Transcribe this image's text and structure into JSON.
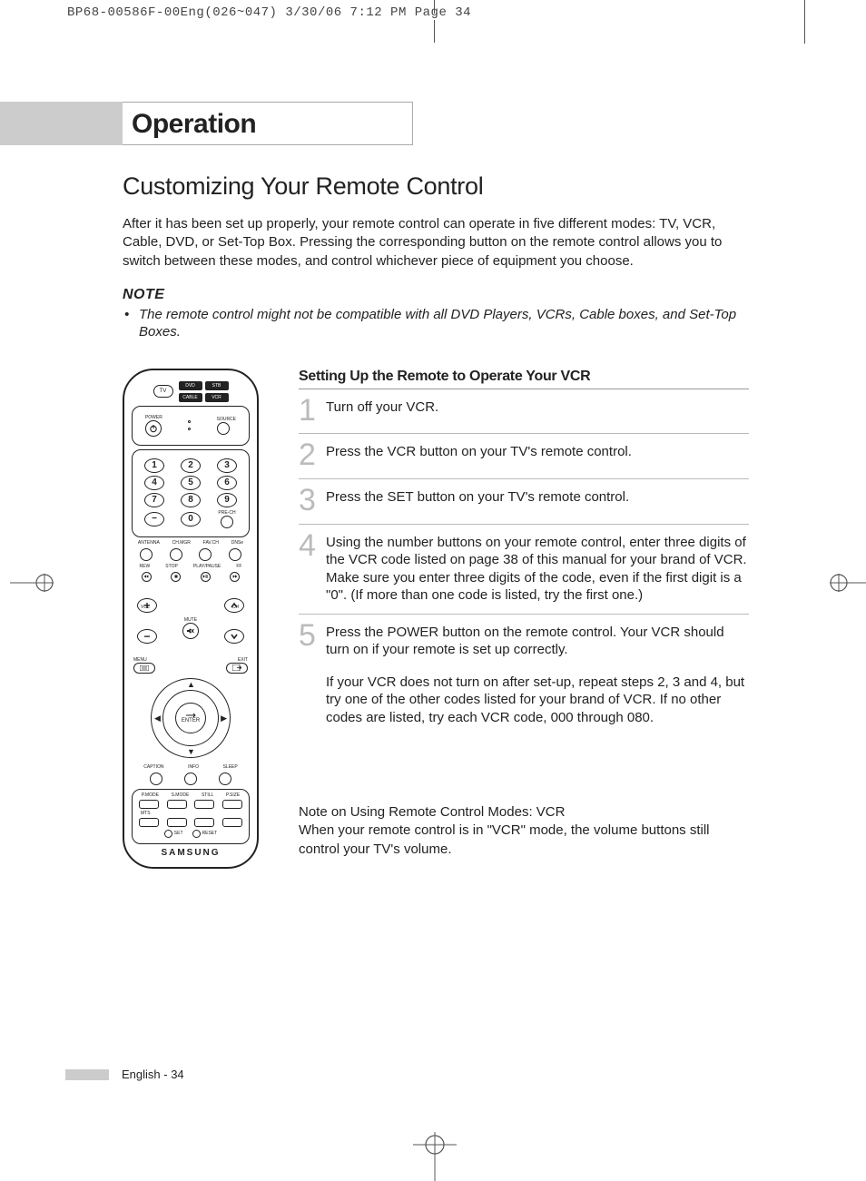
{
  "print_header": "BP68-00586F-00Eng(026~047)  3/30/06  7:12 PM  Page 34",
  "chapter": "Operation",
  "section_title": "Customizing Your Remote Control",
  "intro": "After it has been set up properly, your remote control can operate in five different modes: TV, VCR, Cable, DVD, or Set-Top Box. Pressing the corresponding button on the remote control allows you to switch between these modes, and control whichever piece of equipment you choose.",
  "note_head": "NOTE",
  "note_body": "The remote control might not be compatible with all DVD Players, VCRs, Cable boxes, and Set-Top Boxes.",
  "sub_title": "Setting Up the Remote to Operate Your VCR",
  "steps": [
    {
      "n": "1",
      "text": "Turn off your VCR."
    },
    {
      "n": "2",
      "text": "Press the VCR button on your TV's remote control."
    },
    {
      "n": "3",
      "text": "Press the SET button on your TV's remote control."
    },
    {
      "n": "4",
      "text": "Using the number buttons on your remote control, enter three digits of the VCR code listed on page 38 of this manual for your brand of VCR. Make sure you enter three digits of the code, even if the first digit is a \"0\". (If more than one code is listed, try the first one.)"
    },
    {
      "n": "5",
      "text": "Press the POWER button on the remote control. Your VCR should turn on if your remote is set up correctly.",
      "text2": "If your VCR does not turn on after set-up, repeat steps 2, 3 and 4, but try one of the other codes listed for your brand of VCR. If no other codes are listed, try each VCR code, 000 through 080."
    }
  ],
  "note_modes_1": "Note on Using Remote Control Modes: VCR",
  "note_modes_2": "When your remote control is in \"VCR\" mode, the volume buttons still control your TV's volume.",
  "footer": "English - 34",
  "remote": {
    "tv": "TV",
    "dvd": "DVD",
    "stb": "STB",
    "cable": "CABLE",
    "vcr": "VCR",
    "power": "POWER",
    "source": "SOURCE",
    "nums": [
      "1",
      "2",
      "3",
      "4",
      "5",
      "6",
      "7",
      "8",
      "9",
      "0"
    ],
    "dash": "−",
    "pre_ch": "PRE-CH",
    "antenna": "ANTENNA",
    "chmgr": "CH.MGR",
    "favch": "FAV.CH",
    "dnse": "DNSe",
    "rew": "REW",
    "stop": "STOP",
    "playpause": "PLAY/PAUSE",
    "ff": "FF",
    "vol": "VOL",
    "ch": "CH",
    "mute": "MUTE",
    "menu": "MENU",
    "exit": "EXIT",
    "enter": "ENTER",
    "caption": "CAPTION",
    "info": "INFO",
    "sleep": "SLEEP",
    "pmode": "P.MODE",
    "smode": "S.MODE",
    "still": "STILL",
    "psize": "P.SIZE",
    "mts": "MTS",
    "set": "SET",
    "reset": "RESET",
    "brand": "SAMSUNG"
  }
}
